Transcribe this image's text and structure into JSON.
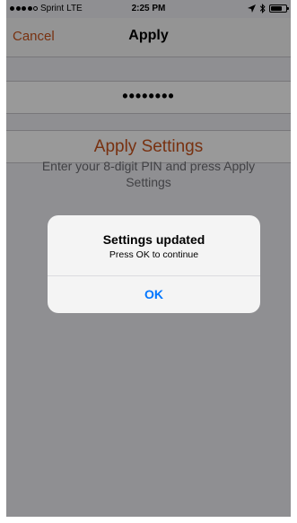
{
  "status_bar": {
    "carrier": "Sprint",
    "network": "LTE",
    "time": "2:25 PM",
    "location_icon": "location-arrow-icon",
    "bluetooth_icon": "bluetooth-icon",
    "battery_level": 0.8
  },
  "nav": {
    "cancel_label": "Cancel",
    "title": "Apply"
  },
  "pin": {
    "masked_value": "••••••••"
  },
  "apply_button_label": "Apply Settings",
  "instructions": "Enter your 8-digit PIN and press Apply Settings",
  "alert": {
    "title": "Settings updated",
    "message": "Press OK to continue",
    "ok_label": "OK"
  },
  "colors": {
    "accent": "#c9531c",
    "alert_button": "#0076ff",
    "background": "#efeff4"
  }
}
